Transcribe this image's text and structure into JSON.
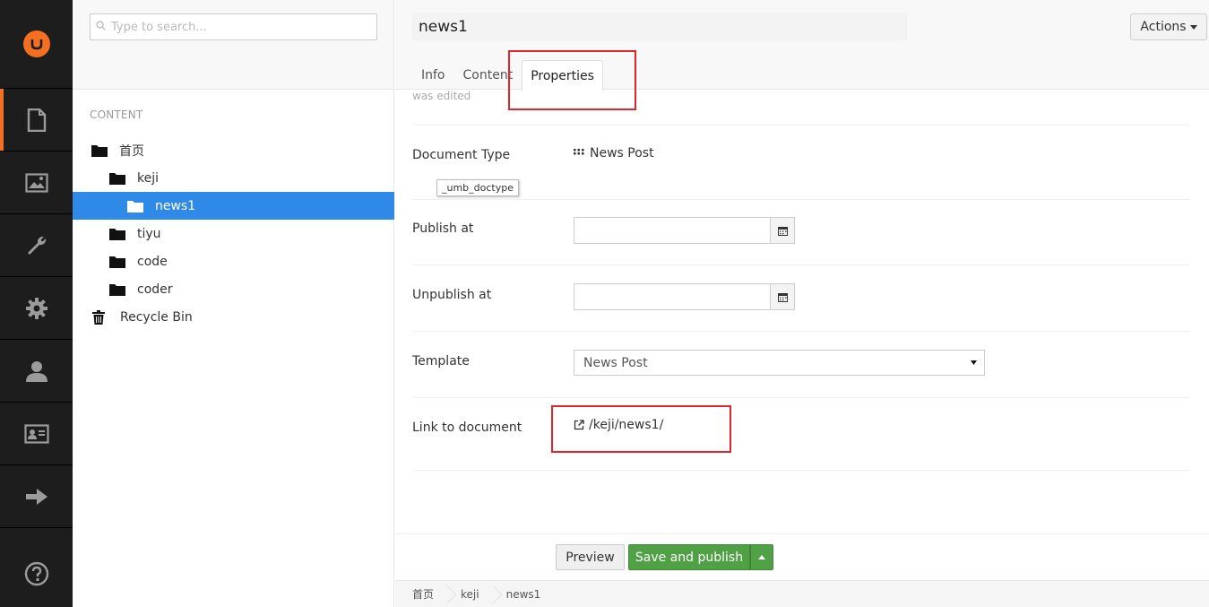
{
  "app": {
    "sections": [
      "content",
      "media",
      "settings",
      "developer",
      "users",
      "members",
      "forms"
    ],
    "accent_color": "#f36f21"
  },
  "tree": {
    "search_placeholder": "Type to search...",
    "section_title": "CONTENT",
    "nodes": [
      {
        "label": "首页"
      },
      {
        "label": "keji"
      },
      {
        "label": "news1"
      },
      {
        "label": "tiyu"
      },
      {
        "label": "code"
      },
      {
        "label": "coder"
      },
      {
        "label": "Recycle Bin"
      }
    ],
    "active_color": "#2e8ae6"
  },
  "editor": {
    "name_value": "news1",
    "actions_label": "Actions",
    "tabs": [
      {
        "label": "Info"
      },
      {
        "label": "Content"
      },
      {
        "label": "Properties"
      }
    ],
    "was_edited": "was edited",
    "properties": {
      "document_type_label": "Document Type",
      "document_type_value": "News Post",
      "document_type_tooltip": "_umb_doctype",
      "publish_at_label": "Publish at",
      "unpublish_at_label": "Unpublish at",
      "template_label": "Template",
      "template_value": "News Post",
      "link_label": "Link to document",
      "link_value": "/keji/news1/"
    },
    "buttons": {
      "preview": "Preview",
      "save_publish": "Save and publish"
    },
    "breadcrumb": [
      "首页",
      "keji",
      "news1"
    ],
    "highlight_color": "#e0262c",
    "save_color": "#50a146"
  }
}
